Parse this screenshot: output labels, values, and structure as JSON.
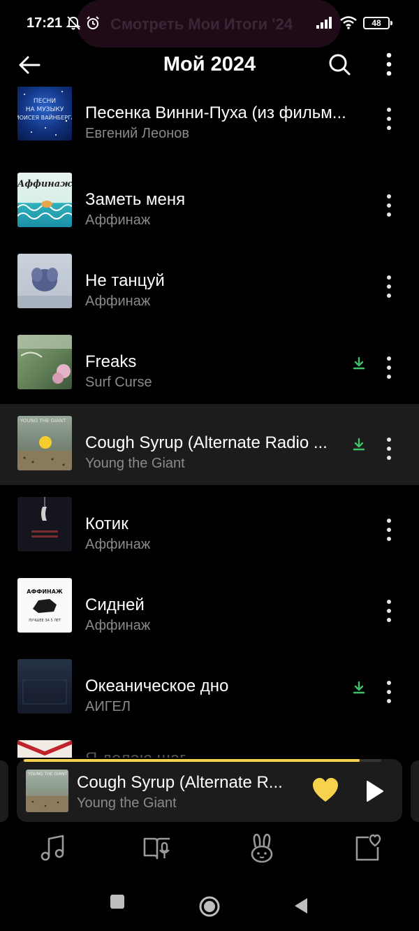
{
  "status_bar": {
    "time": "17:21",
    "banner_text": "Смотреть Мои Итоги '24",
    "battery": "48"
  },
  "header": {
    "title": "Мой 2024"
  },
  "tracks": [
    {
      "title": "Песенка Винни-Пуха (из фильм...",
      "artist": "Евгений Леонов",
      "downloaded": false,
      "cover_text": "ПЕСНИ НА МУЗЫКУ МОИСЕЯ ВАЙНБЕРГА"
    },
    {
      "title": "Заметь меня",
      "artist": "Аффинаж",
      "downloaded": false,
      "cover_text": "Аффинаж"
    },
    {
      "title": "Не танцуй",
      "artist": "Аффинаж",
      "downloaded": false
    },
    {
      "title": "Freaks",
      "artist": "Surf Curse",
      "downloaded": true
    },
    {
      "title": "Cough Syrup (Alternate Radio ...",
      "artist": "Young the Giant",
      "downloaded": true,
      "active": true,
      "cover_text": "YOUNG THE GIANT"
    },
    {
      "title": "Котик",
      "artist": "Аффинаж",
      "downloaded": false
    },
    {
      "title": "Сидней",
      "artist": "Аффинаж",
      "downloaded": false,
      "cover_text": "АФФИНАЖ",
      "cover_subtext": "ЛУЧШЕЕ ЗА 5 ЛЕТ"
    },
    {
      "title": "Океаническое дно",
      "artist": "АИГЕЛ",
      "downloaded": true
    },
    {
      "title": "Я делаю шаг",
      "artist": "",
      "downloaded": false,
      "partial": true
    }
  ],
  "mini_player": {
    "title": "Cough Syrup (Alternate R...",
    "artist": "Young the Giant",
    "progress": 0.94,
    "liked": true,
    "cover_text": "YOUNG THE GIANT"
  },
  "bottom_nav": {
    "items": [
      {
        "icon": "music-note-icon"
      },
      {
        "icon": "podcast-book-icon"
      },
      {
        "icon": "kids-bunny-icon"
      },
      {
        "icon": "collection-heart-icon"
      }
    ]
  },
  "colors": {
    "accent": "#f6d24d",
    "download": "#3ec16b",
    "secondary_text": "#8a8a8a",
    "active_row": "#1c1c1c"
  }
}
